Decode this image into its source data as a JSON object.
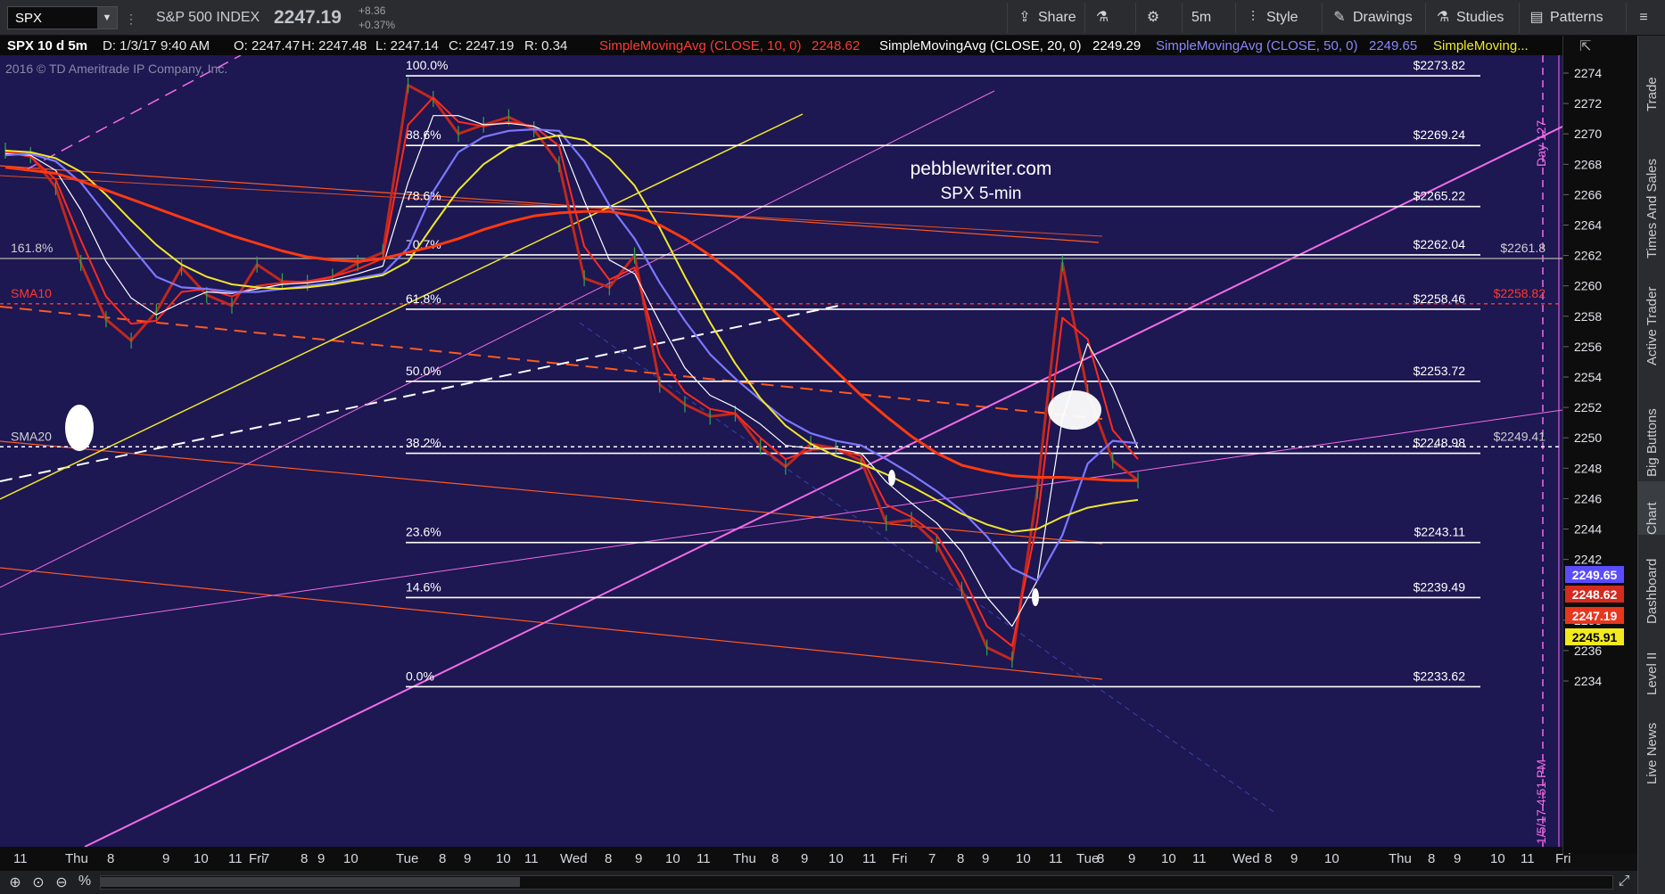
{
  "toolbar": {
    "symbol": "SPX",
    "index_name": "S&P 500 INDEX",
    "last_price": "2247.19",
    "change": "+8.36",
    "change_pct": "+0.37%",
    "share": "Share",
    "timeframe": "5m",
    "style": "Style",
    "drawings": "Drawings",
    "studies": "Studies",
    "patterns": "Patterns"
  },
  "legend": {
    "header": "SPX 10 d 5m",
    "date": "D: 1/3/17 9:40 AM",
    "open": "O: 2247.47",
    "high": "H: 2247.48",
    "low": "L: 2247.14",
    "close": "C: 2247.19",
    "range": "R: 0.34",
    "sma10": "SimpleMovingAvg (CLOSE, 10, 0)",
    "sma10_val": "2248.62",
    "sma20": "SimpleMovingAvg (CLOSE, 20, 0)",
    "sma20_val": "2249.29",
    "sma50": "SimpleMovingAvg (CLOSE, 50, 0)",
    "sma50_val": "2249.65",
    "more": "SimpleMoving..."
  },
  "colors": {
    "background": "#1d1752",
    "sma10": "#ff2b1e",
    "sma20": "#ffffff",
    "sma50": "#7b78ff",
    "sma_yellow": "#f0e82b",
    "trend_magenta": "#f26ce6",
    "price": "#c0281c"
  },
  "chart_data": {
    "type": "line",
    "title": "",
    "watermark": [
      "pebblewriter.com",
      "SPX 5-min"
    ],
    "copyright": "2016 © TD Ameritrade IP Company, Inc.",
    "ylim": [
      2232,
      2275
    ],
    "y_ticks": [
      2234,
      2236,
      2238,
      2240,
      2242,
      2244,
      2246,
      2248,
      2250,
      2252,
      2254,
      2256,
      2258,
      2260,
      2262,
      2264,
      2266,
      2268,
      2270,
      2272,
      2274
    ],
    "y_tick_labels": [
      "2234",
      "2236",
      "2238",
      "2240",
      "2242",
      "2244",
      "2246",
      "2248",
      "2250",
      "2252",
      "2254",
      "2256",
      "2258",
      "2260",
      "2262",
      "2264",
      "2266",
      "2268",
      "2270",
      "2272",
      "2274"
    ],
    "x_labels": [
      "11",
      "Thu",
      "8",
      "9",
      "10",
      "11",
      "Fri",
      "7",
      "8",
      "9",
      "10",
      "Tue",
      "8",
      "9",
      "10",
      "11",
      "Wed",
      "8",
      "9",
      "10",
      "11",
      "Thu",
      "8",
      "9",
      "10",
      "11",
      "Fri",
      "7",
      "8",
      "9",
      "10",
      "11",
      "Tue",
      "8",
      "9",
      "10",
      "11",
      "Wed",
      "8",
      "9",
      "10",
      "Thu",
      "8",
      "9",
      "10",
      "11",
      "Fri"
    ],
    "fib_levels": [
      {
        "pct": "100.0%",
        "price": 2273.82,
        "label": "$2273.82"
      },
      {
        "pct": "88.6%",
        "price": 2269.24,
        "label": "$2269.24"
      },
      {
        "pct": "78.6%",
        "price": 2265.22,
        "label": "$2265.22"
      },
      {
        "pct": "70.7%",
        "price": 2262.04,
        "label": "$2262.04"
      },
      {
        "pct": "61.8%",
        "price": 2258.46,
        "label": "$2258.46"
      },
      {
        "pct": "50.0%",
        "price": 2253.72,
        "label": "$2253.72"
      },
      {
        "pct": "38.2%",
        "price": 2248.98,
        "label": "$2248.98"
      },
      {
        "pct": "23.6%",
        "price": 2243.11,
        "label": "$2243.11"
      },
      {
        "pct": "14.6%",
        "price": 2239.49,
        "label": "$2239.49"
      },
      {
        "pct": "0.0%",
        "price": 2233.62,
        "label": "$2233.62"
      }
    ],
    "horizontal_refs": [
      {
        "label": "161.8%",
        "price": 2261.8,
        "right_label": "$2261.8"
      },
      {
        "label": "SMA10",
        "price": 2258.82,
        "right_label": "$2258.82"
      },
      {
        "label": "SMA20",
        "price": 2249.41,
        "right_label": "$2249.41"
      }
    ],
    "price_tags": [
      {
        "value": "2249.65",
        "color": "#5a4cff"
      },
      {
        "value": "2248.62",
        "color": "#d42a1f"
      },
      {
        "value": "2247.19",
        "color": "#e8371f"
      },
      {
        "value": "2245.91",
        "color": "#f3ea1d"
      }
    ],
    "vertical_labels": [
      "Day 127",
      "1/5/17 4:51 PM"
    ],
    "series": [
      {
        "name": "SPX",
        "values": [
          2268.9,
          2268.6,
          2266.5,
          2261.5,
          2257.8,
          2256.4,
          2258.3,
          2261.2,
          2259.4,
          2258.7,
          2261.4,
          2260.3,
          2260.2,
          2260.6,
          2261.5,
          2262.2,
          2273.2,
          2272.3,
          2270.0,
          2270.6,
          2271.1,
          2270.3,
          2268.0,
          2260.5,
          2259.9,
          2262.0,
          2253.5,
          2252.2,
          2251.4,
          2251.6,
          2249.4,
          2248.1,
          2249.6,
          2249.3,
          2248.5,
          2244.4,
          2244.6,
          2243.0,
          2240.0,
          2236.2,
          2235.4,
          2246.5,
          2261.5,
          2253.0,
          2248.5,
          2247.2
        ]
      },
      {
        "name": "SimpleMovingAvg (CLOSE, 10, 0)",
        "values": [
          2268.8,
          2268.5,
          2267.0,
          2263.0,
          2259.3,
          2257.5,
          2257.7,
          2259.6,
          2259.8,
          2259.3,
          2260.0,
          2260.2,
          2260.3,
          2260.6,
          2261.1,
          2261.8,
          2270.6,
          2272.4,
          2270.8,
          2270.5,
          2270.8,
          2270.5,
          2269.2,
          2262.6,
          2260.4,
          2261.2,
          2255.4,
          2253.0,
          2251.9,
          2251.6,
          2250.0,
          2248.6,
          2249.2,
          2249.3,
          2248.8,
          2245.6,
          2244.8,
          2243.6,
          2241.0,
          2237.6,
          2236.3,
          2244.5,
          2257.9,
          2256.5,
          2250.5,
          2248.6
        ]
      },
      {
        "name": "SimpleMovingAvg (CLOSE, 20, 0)",
        "values": [
          2268.7,
          2268.6,
          2267.6,
          2265.0,
          2261.6,
          2259.2,
          2258.1,
          2258.9,
          2259.6,
          2259.5,
          2259.8,
          2260.1,
          2260.2,
          2260.4,
          2260.8,
          2261.3,
          2266.8,
          2271.2,
          2271.2,
          2270.6,
          2270.7,
          2270.5,
          2269.8,
          2265.6,
          2261.7,
          2260.8,
          2257.6,
          2254.6,
          2252.8,
          2252.0,
          2250.9,
          2249.5,
          2249.3,
          2249.3,
          2249.0,
          2247.1,
          2245.7,
          2244.4,
          2242.5,
          2239.5,
          2237.6,
          2240.6,
          2251.3,
          2256.2,
          2253.3,
          2249.3
        ]
      },
      {
        "name": "SimpleMovingAvg (CLOSE, 50, 0)",
        "values": [
          2268.6,
          2268.7,
          2268.2,
          2266.8,
          2264.7,
          2262.6,
          2260.6,
          2259.9,
          2259.8,
          2259.6,
          2259.6,
          2259.8,
          2260.0,
          2260.2,
          2260.5,
          2260.8,
          2262.5,
          2266.2,
          2268.8,
          2269.8,
          2270.2,
          2270.3,
          2270.2,
          2268.2,
          2265.3,
          2263.1,
          2260.2,
          2257.7,
          2255.5,
          2253.9,
          2252.5,
          2251.2,
          2250.3,
          2249.8,
          2249.5,
          2248.6,
          2247.6,
          2246.5,
          2245.2,
          2243.5,
          2241.4,
          2240.6,
          2243.6,
          2248.3,
          2249.8,
          2249.65
        ]
      },
      {
        "name": "SMA (yellow)",
        "values": [
          2268.9,
          2268.8,
          2268.4,
          2267.5,
          2266.0,
          2264.3,
          2262.7,
          2261.4,
          2260.6,
          2260.1,
          2259.9,
          2259.8,
          2259.9,
          2260.1,
          2260.4,
          2260.7,
          2261.6,
          2264.0,
          2266.3,
          2268.0,
          2269.1,
          2269.6,
          2269.9,
          2269.6,
          2268.4,
          2266.6,
          2263.8,
          2260.6,
          2257.6,
          2254.9,
          2252.6,
          2250.8,
          2249.6,
          2248.8,
          2248.3,
          2247.6,
          2246.8,
          2245.9,
          2245.0,
          2244.3,
          2243.8,
          2244.0,
          2244.8,
          2245.4,
          2245.7,
          2245.91
        ]
      },
      {
        "name": "SMA (red, long)",
        "values": [
          2267.8,
          2267.6,
          2267.4,
          2266.9,
          2266.3,
          2265.7,
          2265.1,
          2264.5,
          2263.9,
          2263.3,
          2262.8,
          2262.3,
          2261.9,
          2261.7,
          2261.6,
          2261.8,
          2262.2,
          2262.6,
          2263.1,
          2263.7,
          2264.2,
          2264.6,
          2264.8,
          2264.9,
          2264.9,
          2264.6,
          2264.0,
          2263.1,
          2262.0,
          2260.7,
          2259.2,
          2257.6,
          2256.0,
          2254.4,
          2252.8,
          2251.4,
          2250.1,
          2249.0,
          2248.2,
          2247.8,
          2247.5,
          2247.4,
          2247.4,
          2247.3,
          2247.2,
          2247.19
        ]
      }
    ]
  },
  "sidebar": [
    "Trade",
    "Times And Sales",
    "Active Trader",
    "Big Buttons",
    "Chart",
    "Dashboard",
    "Level II",
    "Live News"
  ]
}
